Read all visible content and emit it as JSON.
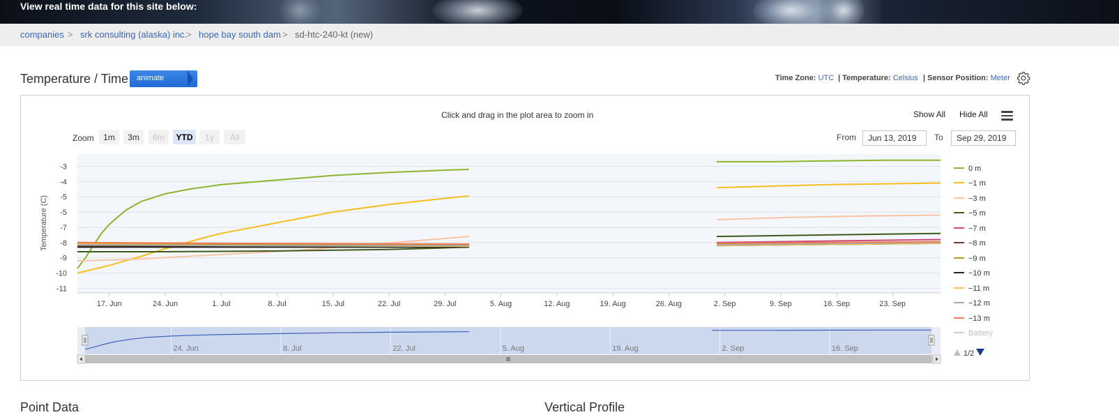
{
  "banner": {
    "text": "View real time data for this site below:"
  },
  "breadcrumb": {
    "items": [
      "companies",
      "srk consulting (alaska) inc.",
      "hope bay south dam",
      "sd-htc-240-kt (new)"
    ],
    "separator": ">"
  },
  "header": {
    "title": "Temperature / Time",
    "animate_label": "animate",
    "timezone_label": "Time Zone:",
    "timezone_value": "UTC",
    "temperature_label": "| Temperature:",
    "temperature_value": "Celsius",
    "position_label": "| Sensor Position:",
    "position_value": "Meter",
    "settings_icon": "gear-icon"
  },
  "chart_toolbar": {
    "hint": "Click and drag in the plot area to zoom in",
    "show_all": "Show All",
    "hide_all": "Hide All",
    "menu_icon": "hamburger-icon",
    "zoom_label": "Zoom",
    "zoom_buttons": [
      {
        "label": "1m",
        "state": "enabled"
      },
      {
        "label": "3m",
        "state": "enabled"
      },
      {
        "label": "6m",
        "state": "disabled"
      },
      {
        "label": "YTD",
        "state": "selected"
      },
      {
        "label": "1y",
        "state": "disabled"
      },
      {
        "label": "All",
        "state": "disabled"
      }
    ],
    "from_label": "From",
    "from_value": "Jun 13, 2019",
    "to_label": "To",
    "to_value": "Sep 29, 2019"
  },
  "legend": {
    "items": [
      {
        "label": "0 m",
        "color": "#8db42a",
        "active": true
      },
      {
        "label": "−1 m",
        "color": "#f7bd1d",
        "active": true
      },
      {
        "label": "−3 m",
        "color": "#f8c4a6",
        "active": true
      },
      {
        "label": "−5 m",
        "color": "#3f5a19",
        "active": true
      },
      {
        "label": "−7 m",
        "color": "#c94a79",
        "active": true
      },
      {
        "label": "−8 m",
        "color": "#6a3a24",
        "active": true
      },
      {
        "label": "−9 m",
        "color": "#b09826",
        "active": true
      },
      {
        "label": "−10 m",
        "color": "#222222",
        "active": true
      },
      {
        "label": "−11 m",
        "color": "#f2c64a",
        "active": true
      },
      {
        "label": "−12 m",
        "color": "#a8a8a8",
        "active": true
      },
      {
        "label": "−13 m",
        "color": "#f07b55",
        "active": true
      },
      {
        "label": "Battery",
        "color": "#cccccc",
        "active": false
      }
    ],
    "page": "1/2"
  },
  "chart_data": {
    "type": "line",
    "title": "",
    "ylabel": "Temperature (C)",
    "yticks": [
      -3,
      -4,
      -5,
      -6,
      -7,
      -8,
      -9,
      -10,
      -11
    ],
    "ytick_labels": [
      "-3",
      "-4",
      "-5",
      "-5",
      "-7",
      "-8",
      "-9",
      "-10",
      "-11"
    ],
    "ylim": [
      -11.3,
      -2.2
    ],
    "x_range": [
      "2019-06-13",
      "2019-09-29"
    ],
    "xticks": [
      {
        "date": "2019-06-17",
        "label": "17. Jun"
      },
      {
        "date": "2019-06-24",
        "label": "24. Jun"
      },
      {
        "date": "2019-07-01",
        "label": "1. Jul"
      },
      {
        "date": "2019-07-08",
        "label": "8. Jul"
      },
      {
        "date": "2019-07-15",
        "label": "15. Jul"
      },
      {
        "date": "2019-07-22",
        "label": "22. Jul"
      },
      {
        "date": "2019-07-29",
        "label": "29. Jul"
      },
      {
        "date": "2019-08-05",
        "label": "5. Aug"
      },
      {
        "date": "2019-08-12",
        "label": "12. Aug"
      },
      {
        "date": "2019-08-19",
        "label": "19. Aug"
      },
      {
        "date": "2019-08-26",
        "label": "26. Aug"
      },
      {
        "date": "2019-09-02",
        "label": "2. Sep"
      },
      {
        "date": "2019-09-09",
        "label": "9. Sep"
      },
      {
        "date": "2019-09-16",
        "label": "16. Sep"
      },
      {
        "date": "2019-09-23",
        "label": "23. Sep"
      }
    ],
    "grid": true,
    "legend_position": "right",
    "series": [
      {
        "name": "0 m",
        "color": "#8db42a",
        "points": [
          [
            "2019-06-13",
            -9.7
          ],
          [
            "2019-06-14",
            -9.0
          ],
          [
            "2019-06-15",
            -8.2
          ],
          [
            "2019-06-16",
            -7.4
          ],
          [
            "2019-06-17",
            -6.8
          ],
          [
            "2019-06-19",
            -5.9
          ],
          [
            "2019-06-21",
            -5.3
          ],
          [
            "2019-06-24",
            -4.8
          ],
          [
            "2019-06-27",
            -4.5
          ],
          [
            "2019-07-01",
            -4.2
          ],
          [
            "2019-07-08",
            -3.9
          ],
          [
            "2019-07-15",
            -3.6
          ],
          [
            "2019-07-22",
            -3.4
          ],
          [
            "2019-07-29",
            -3.25
          ],
          [
            "2019-08-01",
            -3.2
          ],
          null,
          [
            "2019-09-01",
            -2.7
          ],
          [
            "2019-09-08",
            -2.7
          ],
          [
            "2019-09-15",
            -2.65
          ],
          [
            "2019-09-22",
            -2.6
          ],
          [
            "2019-09-29",
            -2.6
          ]
        ]
      },
      {
        "name": "−1 m",
        "color": "#f7bd1d",
        "points": [
          [
            "2019-06-13",
            -10.0
          ],
          [
            "2019-06-17",
            -9.5
          ],
          [
            "2019-06-21",
            -8.9
          ],
          [
            "2019-06-24",
            -8.4
          ],
          [
            "2019-06-28",
            -7.8
          ],
          [
            "2019-07-01",
            -7.4
          ],
          [
            "2019-07-08",
            -6.7
          ],
          [
            "2019-07-15",
            -6.0
          ],
          [
            "2019-07-22",
            -5.5
          ],
          [
            "2019-07-29",
            -5.1
          ],
          [
            "2019-08-01",
            -4.95
          ],
          null,
          [
            "2019-09-01",
            -4.4
          ],
          [
            "2019-09-08",
            -4.3
          ],
          [
            "2019-09-15",
            -4.2
          ],
          [
            "2019-09-22",
            -4.15
          ],
          [
            "2019-09-29",
            -4.1
          ]
        ]
      },
      {
        "name": "−3 m",
        "color": "#f8c4a6",
        "points": [
          [
            "2019-06-13",
            -9.2
          ],
          [
            "2019-06-20",
            -9.1
          ],
          [
            "2019-06-27",
            -8.9
          ],
          [
            "2019-07-04",
            -8.7
          ],
          [
            "2019-07-11",
            -8.5
          ],
          [
            "2019-07-18",
            -8.2
          ],
          [
            "2019-07-25",
            -7.9
          ],
          [
            "2019-08-01",
            -7.6
          ],
          null,
          [
            "2019-09-01",
            -6.5
          ],
          [
            "2019-09-10",
            -6.35
          ],
          [
            "2019-09-20",
            -6.25
          ],
          [
            "2019-09-29",
            -6.2
          ]
        ]
      },
      {
        "name": "−5 m",
        "color": "#3f5a19",
        "points": [
          [
            "2019-06-13",
            -8.6
          ],
          [
            "2019-06-24",
            -8.6
          ],
          [
            "2019-07-08",
            -8.55
          ],
          [
            "2019-07-22",
            -8.45
          ],
          [
            "2019-08-01",
            -8.3
          ],
          null,
          [
            "2019-09-01",
            -7.6
          ],
          [
            "2019-09-15",
            -7.5
          ],
          [
            "2019-09-29",
            -7.4
          ]
        ]
      },
      {
        "name": "−7 m",
        "color": "#c94a79",
        "points": [
          [
            "2019-06-13",
            -8.0
          ],
          [
            "2019-07-01",
            -8.1
          ],
          [
            "2019-08-01",
            -8.1
          ],
          null,
          [
            "2019-09-01",
            -8.0
          ],
          [
            "2019-09-15",
            -7.9
          ],
          [
            "2019-09-29",
            -7.8
          ]
        ]
      },
      {
        "name": "−8 m",
        "color": "#6a3a24",
        "points": [
          [
            "2019-06-13",
            -8.25
          ],
          [
            "2019-07-01",
            -8.25
          ],
          [
            "2019-08-01",
            -8.2
          ],
          null,
          [
            "2019-09-01",
            -8.15
          ],
          [
            "2019-09-29",
            -8.0
          ]
        ]
      },
      {
        "name": "−9 m",
        "color": "#b09826",
        "points": [
          [
            "2019-06-13",
            -8.05
          ],
          [
            "2019-07-01",
            -8.1
          ],
          [
            "2019-08-01",
            -8.15
          ],
          null,
          [
            "2019-09-01",
            -8.1
          ],
          [
            "2019-09-29",
            -7.95
          ]
        ]
      },
      {
        "name": "−10 m",
        "color": "#222222",
        "points": [
          [
            "2019-06-13",
            -8.3
          ],
          [
            "2019-07-01",
            -8.3
          ],
          [
            "2019-08-01",
            -8.3
          ],
          null,
          [
            "2019-09-01",
            -8.2
          ],
          [
            "2019-09-29",
            -8.05
          ]
        ]
      },
      {
        "name": "−11 m",
        "color": "#f2c64a",
        "points": [
          [
            "2019-06-13",
            -8.1
          ],
          [
            "2019-07-01",
            -8.2
          ],
          [
            "2019-08-01",
            -8.25
          ],
          null,
          [
            "2019-09-01",
            -8.2
          ],
          [
            "2019-09-29",
            -8.05
          ]
        ]
      },
      {
        "name": "−12 m",
        "color": "#a8a8a8",
        "points": [
          [
            "2019-06-13",
            -8.15
          ],
          [
            "2019-07-01",
            -8.2
          ],
          [
            "2019-08-01",
            -8.2
          ],
          null,
          [
            "2019-09-01",
            -8.15
          ],
          [
            "2019-09-29",
            -8.0
          ]
        ]
      },
      {
        "name": "−13 m",
        "color": "#f07b55",
        "points": [
          [
            "2019-06-13",
            -8.0
          ],
          [
            "2019-07-01",
            -8.05
          ],
          [
            "2019-08-01",
            -8.1
          ],
          null,
          [
            "2019-09-01",
            -8.05
          ],
          [
            "2019-09-29",
            -7.95
          ]
        ]
      }
    ],
    "navigator": {
      "xticks": [
        {
          "date": "2019-06-24",
          "label": "24. Jun"
        },
        {
          "date": "2019-07-08",
          "label": "8. Jul"
        },
        {
          "date": "2019-07-22",
          "label": "22. Jul"
        },
        {
          "date": "2019-08-05",
          "label": "5. Aug"
        },
        {
          "date": "2019-08-19",
          "label": "19. Aug"
        },
        {
          "date": "2019-09-02",
          "label": "2. Sep"
        },
        {
          "date": "2019-09-16",
          "label": "16. Sep"
        }
      ]
    }
  },
  "lower_sections": {
    "left_title": "Point Data",
    "right_title": "Vertical Profile"
  }
}
